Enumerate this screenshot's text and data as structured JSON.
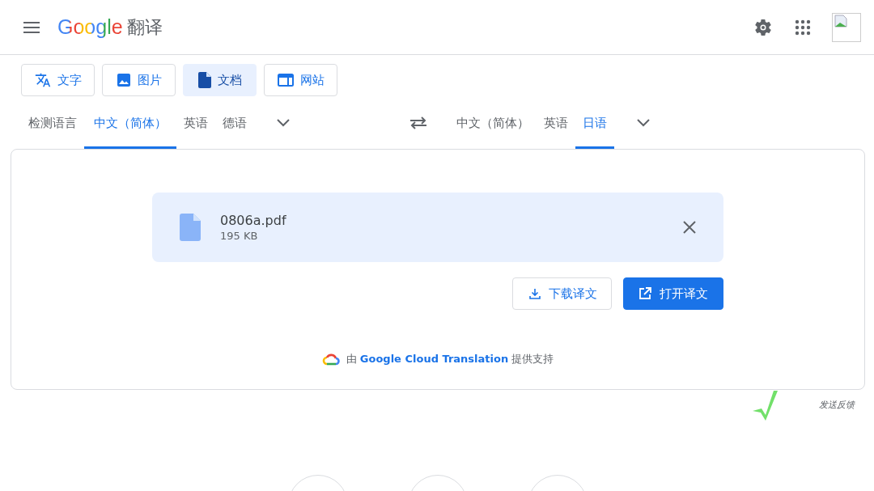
{
  "header": {
    "logo": "Google",
    "product": "翻译"
  },
  "mode_tabs": [
    {
      "label": "文字",
      "kind": "text",
      "selected": false
    },
    {
      "label": "图片",
      "kind": "image",
      "selected": false
    },
    {
      "label": "文档",
      "kind": "document",
      "selected": true
    },
    {
      "label": "网站",
      "kind": "website",
      "selected": false
    }
  ],
  "source_languages": [
    {
      "label": "检测语言",
      "selected": false
    },
    {
      "label": "中文（简体）",
      "selected": true
    },
    {
      "label": "英语",
      "selected": false
    },
    {
      "label": "德语",
      "selected": false
    }
  ],
  "target_languages": [
    {
      "label": "中文（简体）",
      "selected": false
    },
    {
      "label": "英语",
      "selected": false
    },
    {
      "label": "日语",
      "selected": true
    }
  ],
  "file": {
    "name": "0806a.pdf",
    "size": "195 KB"
  },
  "actions": [
    {
      "label": "下载译文",
      "kind": "download"
    },
    {
      "label": "打开译文",
      "kind": "open"
    }
  ],
  "attribution": {
    "prefix": "由",
    "link": "Google Cloud Translation",
    "suffix": "提供支持"
  },
  "feedback": "发送反馈"
}
